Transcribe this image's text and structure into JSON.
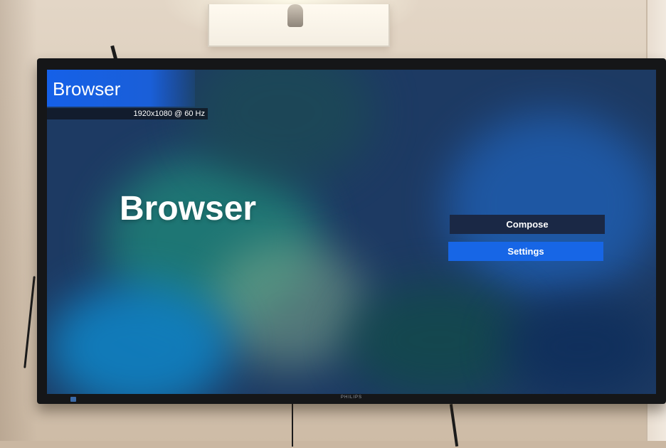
{
  "screen": {
    "title_bar": "Browser",
    "resolution": "1920x1080 @ 60 Hz",
    "heading": "Browser",
    "menu": {
      "compose_label": "Compose",
      "settings_label": "Settings"
    }
  },
  "colors": {
    "accent": "#1766e6",
    "focused_button": "#1a2845",
    "screen_background": "#1d3a63"
  }
}
